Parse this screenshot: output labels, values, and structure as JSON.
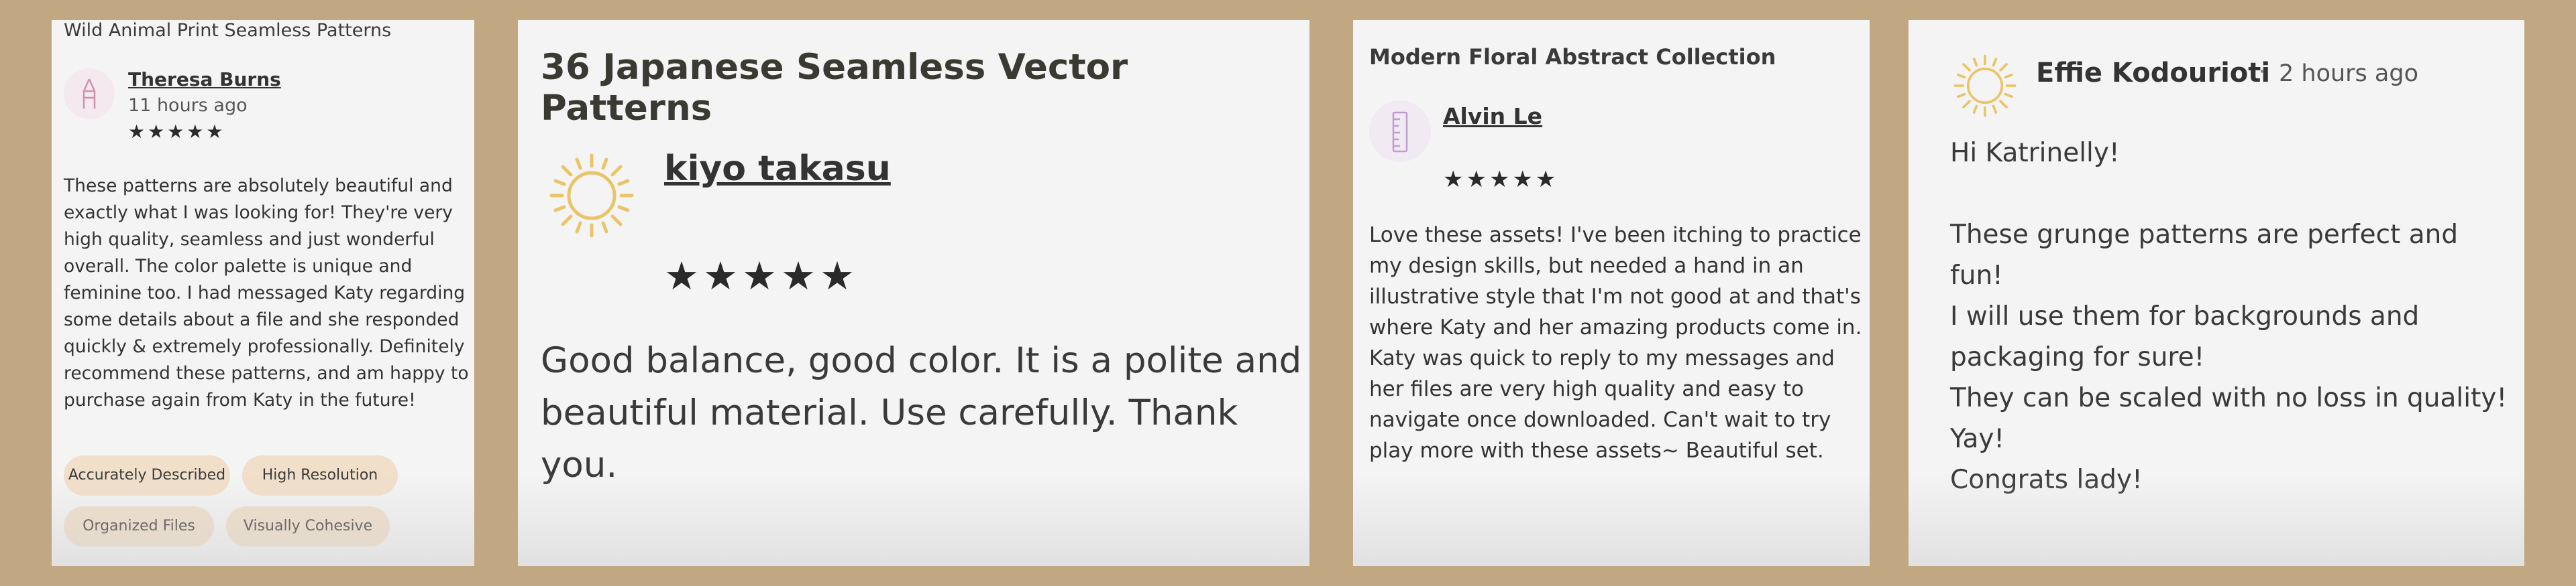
{
  "cards": [
    {
      "title": "Wild Animal Print Seamless Patterns",
      "avatar_icon": "pencil-icon",
      "author": "Theresa Burns",
      "time": "11 hours ago",
      "stars": "★★★★★",
      "rating": 5,
      "body": "These patterns are absolutely beautiful and exactly what I was looking for! They're very high quality, seamless and just wonderful overall. The color palette is unique and feminine too. I had messaged Katy regarding some details about a file and she responded quickly & extremely professionally. Definitely recommend these patterns, and am happy to purchase again from Katy in the future!",
      "tags": [
        "Accurately Described",
        "High Resolution",
        "Organized Files",
        "Visually Cohesive"
      ]
    },
    {
      "title": "36 Japanese Seamless Vector Patterns",
      "avatar_icon": "sun-icon",
      "author": "kiyo takasu",
      "stars": "★★★★★",
      "rating": 5,
      "body": "Good balance, good color. It is a polite and beautiful material. Use carefully. Thank you."
    },
    {
      "title": "Modern Floral Abstract Collection",
      "avatar_icon": "ruler-icon",
      "author": "Alvin Le",
      "stars": "★★★★★",
      "rating": 5,
      "body": "Love these assets! I've been itching to practice my design skills, but needed a hand in an illustrative style that I'm not good at and that's where Katy and her amazing products come in. Katy was quick to reply to my messages and her files are very high quality and easy to navigate once downloaded. Can't wait to try play more with these assets~ Beautiful set."
    },
    {
      "avatar_icon": "sun-icon",
      "author": "Effie Kodourioti",
      "separator": "·",
      "time": "2 hours ago",
      "body": "Hi Katrinelly!\n\nThese grunge patterns are perfect and fun!\nI will use them for backgrounds and packaging for sure!\nThey can be scaled with no loss in quality!\nYay!\nCongrats lady!"
    }
  ],
  "colors": {
    "background": "#c2a882",
    "card": "#f5f4f4",
    "tag": "#f1dfc9",
    "sun": "#e9c46a",
    "avatar_line": "#d48fb0"
  }
}
